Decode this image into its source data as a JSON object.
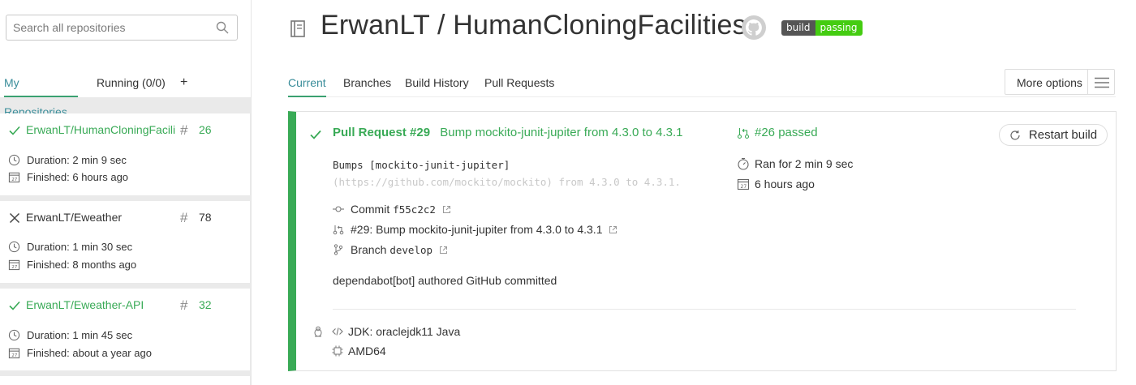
{
  "colors": {
    "passed": "#39aa56",
    "tab_active": "#3a8d9a",
    "badge_left": "#555555",
    "badge_right": "#44cc11"
  },
  "sidebar": {
    "search_placeholder": "Search all repositories",
    "tabs": [
      {
        "label": "My Repositories",
        "active": true
      },
      {
        "label": "Running (0/0)",
        "active": false
      },
      {
        "label": "+",
        "active": false
      }
    ],
    "repos": [
      {
        "name": "ErwanLT/HumanCloningFacilities",
        "status": "passed",
        "number": "26",
        "duration": "Duration: 2 min 9 sec",
        "finished": "Finished: 6 hours ago"
      },
      {
        "name": "ErwanLT/Eweather",
        "status": "failed",
        "number": "78",
        "duration": "Duration: 1 min 30 sec",
        "finished": "Finished: 8 months ago"
      },
      {
        "name": "ErwanLT/Eweather-API",
        "status": "passed",
        "number": "32",
        "duration": "Duration: 1 min 45 sec",
        "finished": "Finished: about a year ago"
      }
    ]
  },
  "header": {
    "title": "ErwanLT / HumanCloningFacilities",
    "badge": {
      "left": "build",
      "right": "passing"
    }
  },
  "main": {
    "tabs": [
      {
        "label": "Current",
        "active": true
      },
      {
        "label": "Branches",
        "active": false
      },
      {
        "label": "Build History",
        "active": false
      },
      {
        "label": "Pull Requests",
        "active": false
      }
    ],
    "more_options": "More options"
  },
  "build": {
    "pr_label": "Pull Request #29",
    "pr_title": "Bump mockito-junit-jupiter from 4.3.0 to 4.3.1",
    "message_line1": "Bumps [mockito-junit-jupiter]",
    "message_line2": "(https://github.com/mockito/mockito) from 4.3.0 to 4.3.1.",
    "commit_label": "Commit",
    "commit_sha": "f55c2c2",
    "pr_link": "#29: Bump mockito-junit-jupiter from 4.3.0 to 4.3.1",
    "branch_label": "Branch",
    "branch_name": "develop",
    "author_line": "dependabot[bot] authored GitHub committed",
    "build_number_status": "#26 passed",
    "ran_for": "Ran for 2 min 9 sec",
    "finished": "6 hours ago",
    "restart_label": "Restart build",
    "jdk": "JDK: oraclejdk11 Java",
    "arch": "AMD64"
  }
}
